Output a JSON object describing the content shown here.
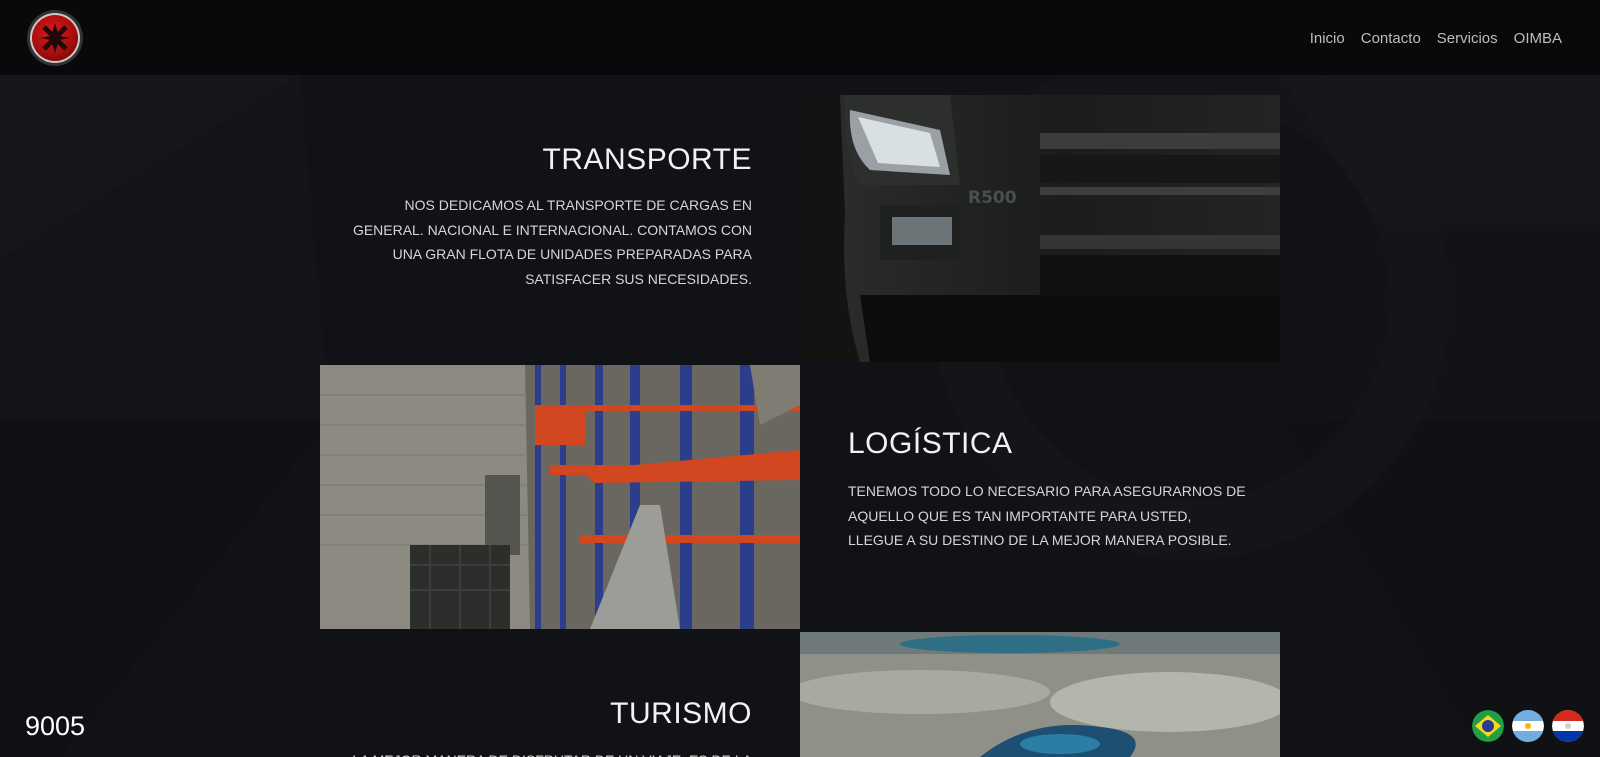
{
  "nav": {
    "items": [
      {
        "label": "Inicio"
      },
      {
        "label": "Contacto"
      },
      {
        "label": "Servicios"
      },
      {
        "label": "OIMBA"
      }
    ]
  },
  "sections": {
    "transporte": {
      "title": "TRANSPORTE",
      "lines": [
        "NOS DEDICAMOS AL TRANSPORTE DE CARGAS EN",
        "GENERAL. NACIONAL E INTERNACIONAL. CONTAMOS CON",
        "UNA GRAN FLOTA DE UNIDADES PREPARADAS PARA",
        "SATISFACER SUS NECESIDADES."
      ],
      "photo_badge": "R500"
    },
    "logistica": {
      "title": "LOGÍSTICA",
      "lines": [
        "TENEMOS TODO LO NECESARIO PARA ASEGURARNOS DE",
        "AQUELLO QUE ES TAN IMPORTANTE PARA USTED,",
        "LLEGUE A SU DESTINO DE LA MEJOR MANERA POSIBLE."
      ]
    },
    "turismo": {
      "title": "TURISMO",
      "lines": [
        "LA MEJOR MANERA DE DISFRUTAR DE UN VIAJE, ES DE LA"
      ]
    }
  },
  "counter": "9005",
  "flags": [
    {
      "name": "brazil-flag-icon"
    },
    {
      "name": "argentina-flag-icon"
    },
    {
      "name": "paraguay-flag-icon"
    }
  ],
  "colors": {
    "background": "#111216",
    "header": "#08090b",
    "logo_red": "#e01a1a"
  }
}
